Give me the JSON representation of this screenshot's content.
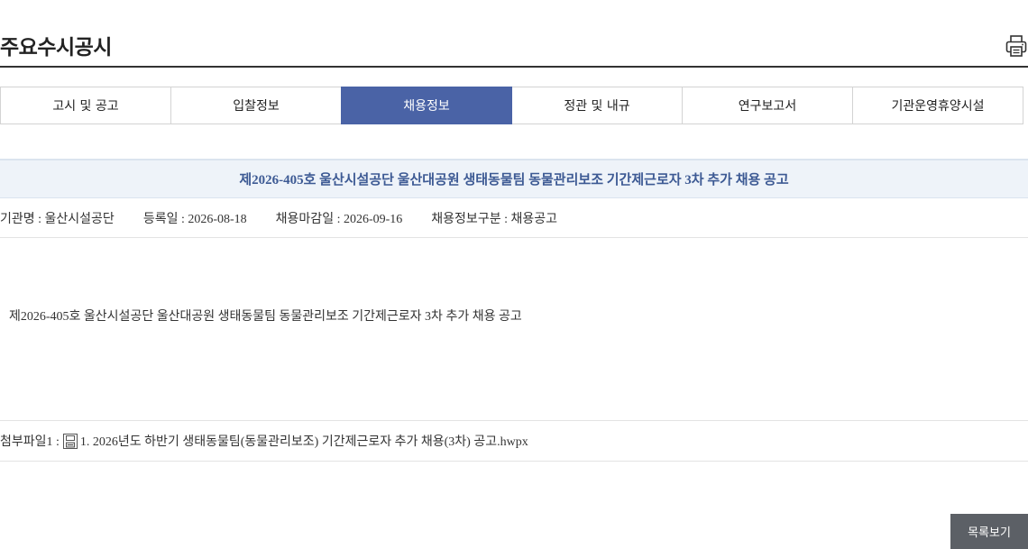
{
  "page": {
    "title": "주요수시공시",
    "print_icon": "printer-icon"
  },
  "tabs": [
    {
      "label": "고시 및 공고",
      "active": false
    },
    {
      "label": "입찰정보",
      "active": false
    },
    {
      "label": "채용정보",
      "active": true
    },
    {
      "label": "정관 및 내규",
      "active": false
    },
    {
      "label": "연구보고서",
      "active": false
    },
    {
      "label": "기관운영휴양시설",
      "active": false
    }
  ],
  "post": {
    "title": "제2026-405호 울산시설공단 울산대공원 생태동물팀 동물관리보조 기간제근로자 3차 추가 채용 공고",
    "meta": {
      "agency": "기관명 : 울산시설공단",
      "registered": "등록일 : 2026-08-18",
      "deadline": "채용마감일 : 2026-09-16",
      "category": "채용정보구분 : 채용공고"
    },
    "body": "제2026-405호 울산시설공단 울산대공원 생태동물팀 동물관리보조 기간제근로자 3차 추가 채용 공고",
    "attachment": {
      "label": "첨부파일1 :",
      "icon": "file-icon",
      "filename": "1. 2026년도 하반기 생태동물팀(동물관리보조) 기간제근로자 추가 채용(3차) 공고.hwpx"
    }
  },
  "actions": {
    "list_label": "목록보기"
  },
  "colors": {
    "tab_active_bg": "#4a63a6",
    "title_bar_bg": "#eef3f9",
    "title_text": "#3d5a94",
    "list_button_bg": "#5c6066"
  }
}
